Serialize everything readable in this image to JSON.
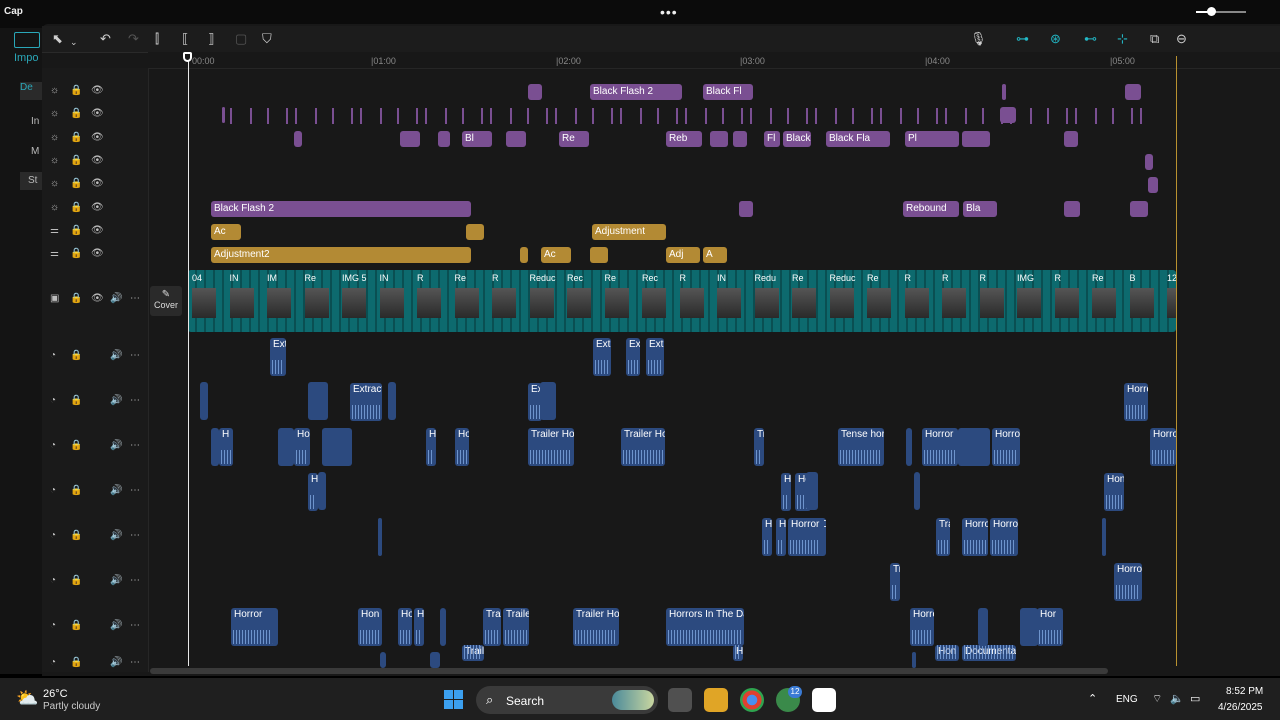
{
  "app": {
    "title": "Cap",
    "more_label": "•••"
  },
  "left_panel": {
    "items": [
      "Impo",
      "De",
      "In",
      "M",
      "St"
    ]
  },
  "toolbar": {
    "icons": [
      "select-icon",
      "chevron-down-icon",
      "undo-icon",
      "redo-icon",
      "split-icon",
      "split-left-icon",
      "split-right-icon",
      "delete-icon",
      "marker-icon",
      "microphone-icon",
      "link-icon",
      "magnet-icon",
      "preview-axis-icon",
      "align-icon",
      "screen-icon",
      "zoom-out-icon"
    ],
    "zoom_level": 0.3
  },
  "ruler": {
    "labels": [
      "00:00",
      "|01:00",
      "|02:00",
      "|03:00",
      "|04:00",
      "|05:00"
    ]
  },
  "cover": {
    "label": "Cover"
  },
  "effect_tracks": [
    {
      "clips": [
        "",
        "Black Flash 2",
        "Black Fl",
        "",
        ""
      ]
    },
    {
      "clips": [
        "",
        ""
      ]
    },
    {
      "clips": [
        "",
        "",
        "",
        "Bl",
        "",
        "Re",
        "Reb",
        "",
        "",
        "Fl",
        "Black Flash",
        "Black Fla",
        "Pl",
        ""
      ]
    },
    {
      "clips": [
        ""
      ]
    },
    {
      "clips": [
        ""
      ]
    },
    {
      "clips": [
        "Black Flash 2",
        "",
        "Rebound",
        "Bla",
        "",
        ""
      ]
    }
  ],
  "adjust_tracks": [
    {
      "clips": [
        "Ac",
        "",
        "Adjustment"
      ]
    },
    {
      "clips": [
        "Adjustment2",
        "",
        "Ac",
        "",
        "Adj",
        "A"
      ]
    }
  ],
  "video_labels": [
    "04",
    "IN",
    "IM",
    "Re",
    "IMG 5",
    "IN",
    "R",
    "Re",
    "R",
    "Reduc",
    "Rec",
    "Re",
    "Rec",
    "R",
    "IN",
    "Redu",
    "Re",
    "Reduc",
    "Re",
    "R",
    "R",
    "R",
    "IMG",
    "R",
    "Re",
    "B",
    "12"
  ],
  "audio_tracks": [
    {
      "clips": [
        "Ext",
        "Extr",
        "Ex",
        "Extr"
      ]
    },
    {
      "clips": [
        "Extract",
        "Ex",
        "Horro"
      ]
    },
    {
      "clips": [
        "H",
        "Ho",
        "H",
        "Ho",
        "Trailer Ho",
        "Trailer Ho",
        "Tr",
        "Tense horr",
        "Horror",
        "Horro",
        "Horro"
      ]
    },
    {
      "clips": [
        "H",
        "H",
        "Ho",
        "Hon"
      ]
    },
    {
      "clips": [
        "H",
        "H",
        "Horror D",
        "Tra",
        "Horro",
        "Horro"
      ]
    },
    {
      "clips": [
        "Tr",
        "Horro"
      ]
    },
    {
      "clips": [
        "Horror",
        "Hon",
        "Ho",
        "H",
        "Tra",
        "Traile",
        "Trailer Ho",
        "Horrors In The Da",
        "Horro",
        "Hor"
      ]
    },
    {
      "clips": [
        "Trail",
        "Ho",
        "Hon",
        "Documenta"
      ]
    }
  ],
  "taskbar": {
    "weather_temp": "26°C",
    "weather_desc": "Partly cloudy",
    "search_label": "Search",
    "badge_count": "12",
    "language": "ENG",
    "time": "8:52 PM",
    "date": "4/26/2025"
  }
}
